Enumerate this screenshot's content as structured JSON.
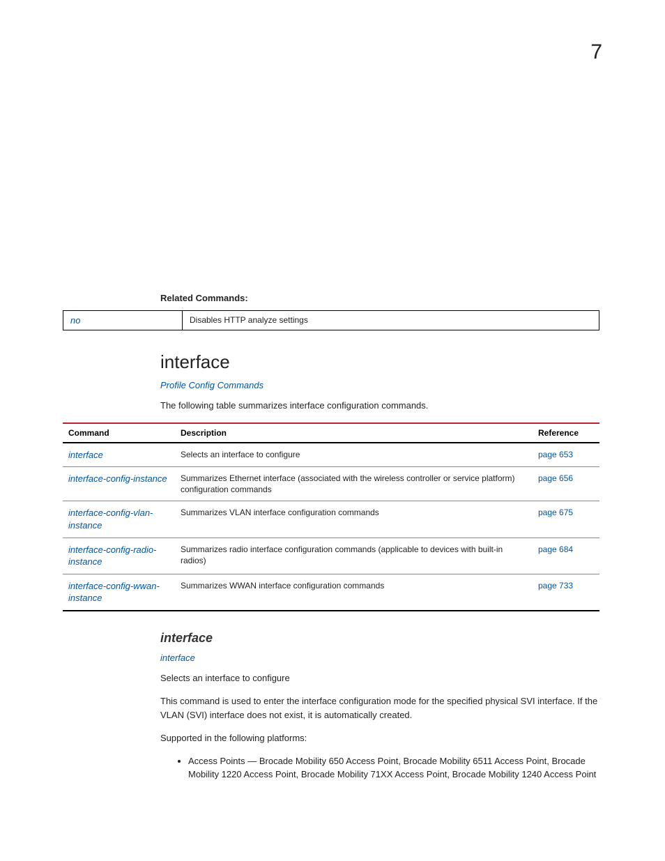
{
  "page_number": "7",
  "related_commands_label": "Related Commands:",
  "related_row": {
    "cmd": "no",
    "desc": "Disables HTTP analyze settings"
  },
  "section_heading": "interface",
  "section_subtitle": "Profile Config Commands",
  "section_intro": "The following table summarizes interface configuration commands.",
  "table_headers": {
    "command": "Command",
    "description": "Description",
    "reference": "Reference"
  },
  "table_rows": [
    {
      "cmd": "interface",
      "desc": "Selects an interface to configure",
      "ref": "page 653"
    },
    {
      "cmd": "interface-config-instance",
      "desc": "Summarizes Ethernet interface (associated with the wireless controller or service platform) configuration commands",
      "ref": "page 656"
    },
    {
      "cmd": "interface-config-vlan-instance",
      "desc": "Summarizes VLAN interface configuration commands",
      "ref": "page 675"
    },
    {
      "cmd": "interface-config-radio-instance",
      "desc": "Summarizes radio interface configuration commands (applicable to devices with built-in radios)",
      "ref": "page 684"
    },
    {
      "cmd": "interface-config-wwan-instance",
      "desc": "Summarizes WWAN interface configuration commands",
      "ref": "page 733"
    }
  ],
  "sub_heading": "interface",
  "sub_link": "interface",
  "sub_desc": "Selects an interface to configure",
  "sub_body": "This command is used to enter the interface configuration mode for the specified physical SVI interface. If the VLAN (SVI) interface does not exist, it is automatically created.",
  "supported_label": "Supported in the following platforms:",
  "supported_bullet": "Access Points — Brocade Mobility 650 Access Point, Brocade Mobility 6511 Access Point, Brocade Mobility 1220 Access Point, Brocade Mobility 71XX Access Point, Brocade Mobility 1240 Access Point"
}
